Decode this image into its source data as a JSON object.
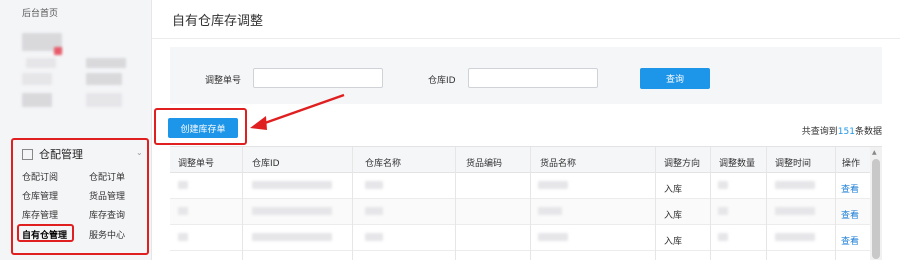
{
  "sidebar": {
    "home_label": "后台首页",
    "section_title": "仓配管理",
    "items": [
      {
        "label": "仓配订阅"
      },
      {
        "label": "仓配订单"
      },
      {
        "label": "仓库管理"
      },
      {
        "label": "货品管理"
      },
      {
        "label": "库存管理"
      },
      {
        "label": "库存查询"
      },
      {
        "label": "自有仓管理",
        "active": true
      },
      {
        "label": "服务中心"
      }
    ]
  },
  "page": {
    "title": "自有仓库存调整"
  },
  "filter": {
    "adjust_no_label": "调整单号",
    "adjust_no_value": "",
    "warehouse_id_label": "仓库ID",
    "warehouse_id_value": "",
    "query_button": "查询"
  },
  "toolbar": {
    "create_button": "创建库存单",
    "total_prefix": "共查询到",
    "total_count": "151",
    "total_suffix": "条数据"
  },
  "table": {
    "headers": [
      "调整单号",
      "仓库ID",
      "仓库名称",
      "货品编码",
      "货品名称",
      "调整方向",
      "调整数量",
      "调整时间",
      "操作"
    ],
    "rows": [
      {
        "direction": "入库",
        "action": "查看"
      },
      {
        "direction": "入库",
        "action": "查看"
      },
      {
        "direction": "入库",
        "action": "查看"
      }
    ]
  },
  "colors": {
    "accent": "#1d95e8",
    "annotation": "#e02020",
    "link": "#1d7fd8"
  }
}
